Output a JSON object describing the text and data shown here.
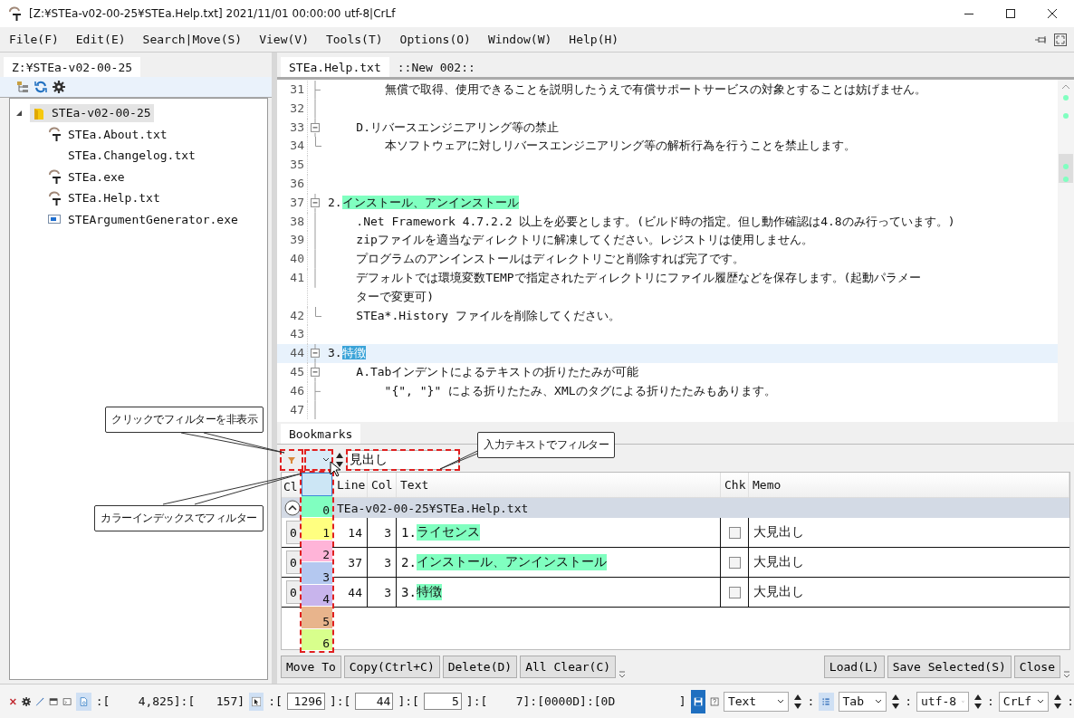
{
  "window": {
    "title": "[Z:¥STEa-v02-00-25¥STEa.Help.txt] 2021/11/01 00:00:00 utf-8|CrLf"
  },
  "menu": [
    "File(F)",
    "Edit(E)",
    "Search|Move(S)",
    "View(V)",
    "Tools(T)",
    "Options(O)",
    "Window(W)",
    "Help(H)"
  ],
  "explorer": {
    "tab": "Z:¥STEa-v02-00-25",
    "tree": [
      {
        "label": "STEa-v02-00-25",
        "kind": "folder",
        "selected": true,
        "expanded": true,
        "children": [
          {
            "label": "STEa.About.txt",
            "kind": "app",
            "selected": false
          },
          {
            "label": "STEa.Changelog.txt",
            "kind": "plain",
            "selected": false
          },
          {
            "label": "STEa.exe",
            "kind": "app",
            "selected": false
          },
          {
            "label": "STEa.Help.txt",
            "kind": "app",
            "selected": false
          },
          {
            "label": "STEArgumentGenerator.exe",
            "kind": "window",
            "selected": false
          }
        ]
      }
    ]
  },
  "editor_tabs": [
    {
      "label": "STEa.Help.txt",
      "selected": true
    },
    {
      "label": "::New 002::",
      "selected": false
    }
  ],
  "editor": {
    "lines": [
      {
        "num": "31",
        "kind": "tick",
        "text": "        無償で取得、使用できることを説明したうえで有償サポートサービスの対象とすることは妨げません。"
      },
      {
        "num": "32",
        "kind": "line"
      },
      {
        "num": "33",
        "kind": "open",
        "text": "    D.リバースエンジニアリング等の禁止"
      },
      {
        "num": "34",
        "kind": "end",
        "text": "        本ソフトウェアに対しリバースエンジニアリング等の解析行為を行うことを禁止します。"
      },
      {
        "num": "35",
        "kind": "plain"
      },
      {
        "num": "36",
        "kind": "plain"
      },
      {
        "num": "37",
        "kind": "open",
        "text": "2.",
        "highlight": {
          "text": "インストール、アンインストール",
          "kind": "bookmark"
        }
      },
      {
        "num": "38",
        "kind": "line",
        "text": "    .Net Framework 4.7.2.2 以上を必要とします。(ビルド時の指定。但し動作確認は4.8のみ行っています。)"
      },
      {
        "num": "39",
        "kind": "line",
        "text": "    zipファイルを適当なディレクトリに解凍してください。レジストリは使用しません。"
      },
      {
        "num": "40",
        "kind": "line",
        "text": "    プログラムのアンインストールはディレクトリごと削除すれば完了です。"
      },
      {
        "num": "41",
        "kind": "line",
        "text": "    デフォルトでは環境変数TEMPで指定されたディレクトリにファイル履歴などを保存します。(起動パラメー",
        "wrapped": "    ターで変更可)"
      },
      {
        "num": "42",
        "kind": "end",
        "text": "    STEa*.History ファイルを削除してください。"
      },
      {
        "num": "43",
        "kind": "plain"
      },
      {
        "num": "44",
        "kind": "open",
        "current": true,
        "text": "3.",
        "highlight": {
          "text": "特徴",
          "kind": "selection"
        }
      },
      {
        "num": "45",
        "kind": "open",
        "text": "    A.Tabインデントによるテキストの折りたたみが可能"
      },
      {
        "num": "46",
        "kind": "tick",
        "text": "        \"{\", \"}\" による折りたたみ、XMLのタグによる折りたたみもあります。"
      },
      {
        "num": "47",
        "kind": "line"
      }
    ]
  },
  "bookmarks": {
    "tab": "Bookmarks",
    "filter_text": "見出し",
    "color_options": [
      {
        "selected": true,
        "color": "#cce6f5"
      },
      {
        "label": "0",
        "selected": false,
        "color": "#80ffc0"
      },
      {
        "label": "1",
        "selected": false,
        "color": "#ffff80"
      },
      {
        "label": "2",
        "selected": false,
        "color": "#ffb4d8"
      },
      {
        "label": "3",
        "selected": false,
        "color": "#b4c8f0"
      },
      {
        "label": "4",
        "selected": false,
        "color": "#c8b4ec"
      },
      {
        "label": "5",
        "selected": false,
        "color": "#e8b48c"
      },
      {
        "label": "6",
        "selected": false,
        "color": "#d8ff8c"
      }
    ],
    "columns": [
      "Cl",
      "Line",
      "Col",
      "Text",
      "Chk",
      "Memo"
    ],
    "group": {
      "label": "TEa-v02-00-25¥STEa.Help.txt",
      "expanded": true
    },
    "rows": [
      {
        "cl": "0",
        "line": "14",
        "col": "3",
        "prefix": "1.",
        "highlight": "ライセンス",
        "color": "#80ffc0",
        "checked": false,
        "memo": "大見出し"
      },
      {
        "cl": "0",
        "line": "37",
        "col": "3",
        "prefix": "2.",
        "highlight": "インストール、アンインストール",
        "color": "#80ffc0",
        "checked": false,
        "memo": "大見出し"
      },
      {
        "cl": "0",
        "line": "44",
        "col": "3",
        "prefix": "3.",
        "highlight": "特徴",
        "color": "#80ffc0",
        "checked": false,
        "memo": "大見出し"
      }
    ],
    "buttons_left": [
      "Move To",
      "Copy(Ctrl+C)",
      "Delete(D)",
      "All Clear(C)"
    ],
    "buttons_right": [
      "Load(L)",
      "Save Selected(S)",
      "Close"
    ]
  },
  "callouts": [
    "クリックでフィルターを非表示",
    "入力テキストでフィルター",
    "カラーインデックスでフィルター"
  ],
  "status_bar": {
    "position": [
      {
        "kind": "text",
        "text": ":[    4,825]:[   157]"
      }
    ],
    "cursor": [
      {
        "kind": "text",
        "text": ":["
      },
      {
        "kind": "field",
        "text": "1296"
      },
      {
        "kind": "text",
        "text": "]:["
      },
      {
        "kind": "field",
        "text": "44"
      },
      {
        "kind": "text",
        "text": "]:["
      },
      {
        "kind": "field",
        "text": "5"
      },
      {
        "kind": "text",
        "text": "]:[    7]:[0000D]:[0D         ]"
      }
    ],
    "combos": [
      {
        "value": "Text",
        "separator": ":"
      },
      {
        "value": "Tab",
        "separator": ":"
      },
      {
        "value": "utf-8",
        "separator": ":"
      },
      {
        "value": "CrLf",
        "separator": ":"
      }
    ]
  }
}
